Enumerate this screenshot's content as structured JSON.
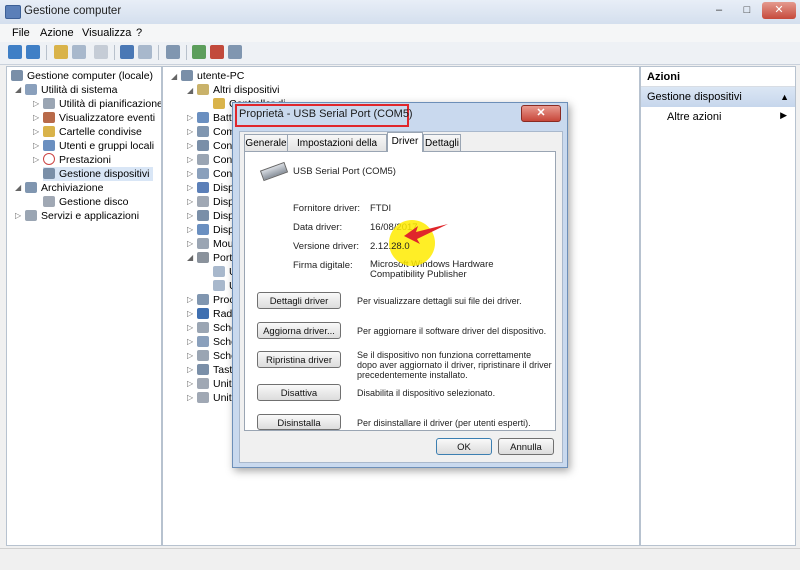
{
  "window": {
    "title": "Gestione computer",
    "controls": [
      "–",
      "□",
      "✕"
    ]
  },
  "menu": [
    "File",
    "Azione",
    "Visualizza",
    "?"
  ],
  "left_tree": {
    "root": "Gestione computer (locale)",
    "items": [
      {
        "label": "Utilità di sistema"
      },
      {
        "label": "Utilità di pianificazione"
      },
      {
        "label": "Visualizzatore eventi"
      },
      {
        "label": "Cartelle condivise"
      },
      {
        "label": "Utenti e gruppi locali"
      },
      {
        "label": "Prestazioni"
      },
      {
        "label": "Gestione dispositivi"
      },
      {
        "label": "Archiviazione"
      },
      {
        "label": "Gestione disco"
      },
      {
        "label": "Servizi e applicazioni"
      }
    ]
  },
  "device_tree": {
    "root": "utente-PC",
    "items": [
      "Altri dispositivi",
      "Controller di",
      "Batte",
      "Com",
      "Cont",
      "Cont",
      "Cont",
      "Disp",
      "Disp",
      "Disp",
      "Disp",
      "Mou",
      "Porte",
      "U",
      "U",
      "Proc",
      "Radi",
      "Sche",
      "Sche",
      "Sche",
      "Tasti",
      "Unità",
      "Unità"
    ]
  },
  "actions_pane": {
    "header": "Azioni",
    "section": "Gestione dispositivi",
    "item": "Altre azioni",
    "arrow_up": "▲",
    "arrow_right": "▶"
  },
  "dialog": {
    "title": "Proprietà - USB Serial Port (COM5)",
    "close": "✕",
    "tabs": [
      "Generale",
      "Impostazioni della porta",
      "Driver",
      "Dettagli"
    ],
    "device_name": "USB Serial Port (COM5)",
    "fields": [
      {
        "label": "Fornitore driver:",
        "value": "FTDI"
      },
      {
        "label": "Data driver:",
        "value": "16/08/2017"
      },
      {
        "label": "Versione driver:",
        "value": "2.12.28.0"
      },
      {
        "label": "Firma digitale:",
        "value": "Microsoft Windows Hardware Compatibility Publisher"
      }
    ],
    "buttons": [
      {
        "label": "Dettagli driver",
        "desc": "Per visualizzare dettagli sui file dei driver."
      },
      {
        "label": "Aggiorna driver...",
        "desc": "Per aggiornare il software driver del dispositivo."
      },
      {
        "label": "Ripristina driver",
        "desc": "Se il dispositivo non funziona correttamente dopo aver aggiornato il driver, ripristinare il driver precedentemente installato."
      },
      {
        "label": "Disattiva",
        "desc": "Disabilita il dispositivo selezionato."
      },
      {
        "label": "Disinstalla",
        "desc": "Per disinstallare il driver (per utenti esperti)."
      }
    ],
    "ok": "OK",
    "cancel": "Annulla"
  }
}
